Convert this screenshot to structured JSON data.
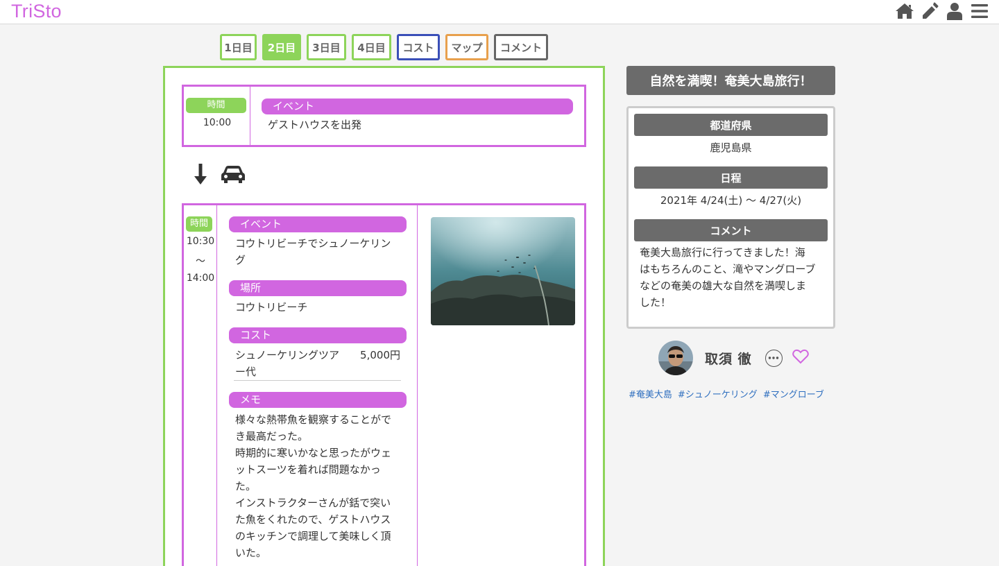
{
  "header": {
    "logo": "TriSto",
    "icons": [
      "home-icon",
      "pencil-icon",
      "user-icon",
      "menu-icon"
    ]
  },
  "tabs": [
    {
      "label": "1日目",
      "active": false
    },
    {
      "label": "2日目",
      "active": true
    },
    {
      "label": "3日目",
      "active": false
    },
    {
      "label": "4日目",
      "active": false
    },
    {
      "label": "コスト",
      "active": false
    },
    {
      "label": "マップ",
      "active": false
    },
    {
      "label": "コメント",
      "active": false
    }
  ],
  "schedule": {
    "event1": {
      "time_label": "時間",
      "time": "10:00",
      "event_label": "イベント",
      "event_text": "ゲストハウスを出発"
    },
    "transit_icons": [
      "arrow-down-icon",
      "car-icon"
    ],
    "event2": {
      "time_label": "時間",
      "start": "10:30",
      "tilde": "〜",
      "end": "14:00",
      "event_label": "イベント",
      "event_lines": [
        "コウトリビーチでシュノーケリン",
        "グ"
      ],
      "place_label": "場所",
      "place": "コウトリビーチ",
      "cost_label": "コスト",
      "cost_item_lines": [
        "シュノーケリングツア",
        "ー代"
      ],
      "cost_amount": "5,000円",
      "memo_label": "メモ",
      "memo_lines": [
        "様々な熱帯魚を観察することがで",
        "き最高だった。",
        "時期的に寒いかなと思ったがウェ",
        "ットスーツを着れば問題なかっ",
        "た。",
        "インストラクターさんが銛で突い",
        "た魚をくれたので、ゲストハウス",
        "のキッチンで調理して美味しく頂",
        "いた。"
      ]
    }
  },
  "sidebar": {
    "title": "自然を満喫！奄美大島旅行！",
    "prefecture_label": "都道府県",
    "prefecture": "鹿児島県",
    "dates_label": "日程",
    "dates": "2021年 4/24(土) 〜 4/27(火)",
    "comment_label": "コメント",
    "comment_lines": [
      "奄美大島旅行に行ってきました！海",
      "はもちろんのこと、滝やマングローブ",
      "などの奄美の雄大な自然を満喫しま",
      "した！"
    ],
    "user_name": "取須 徹",
    "tags": [
      "#奄美大島",
      "#シュノーケリング",
      "#マングローブ"
    ]
  },
  "colors": {
    "accent_pink": "#d166e0",
    "accent_green": "#8dd45a",
    "cost_blue": "#3a4fb8",
    "map_orange": "#e8a04d",
    "heading_gray": "#6b6b6b",
    "tag_blue": "#2f6fbf"
  }
}
